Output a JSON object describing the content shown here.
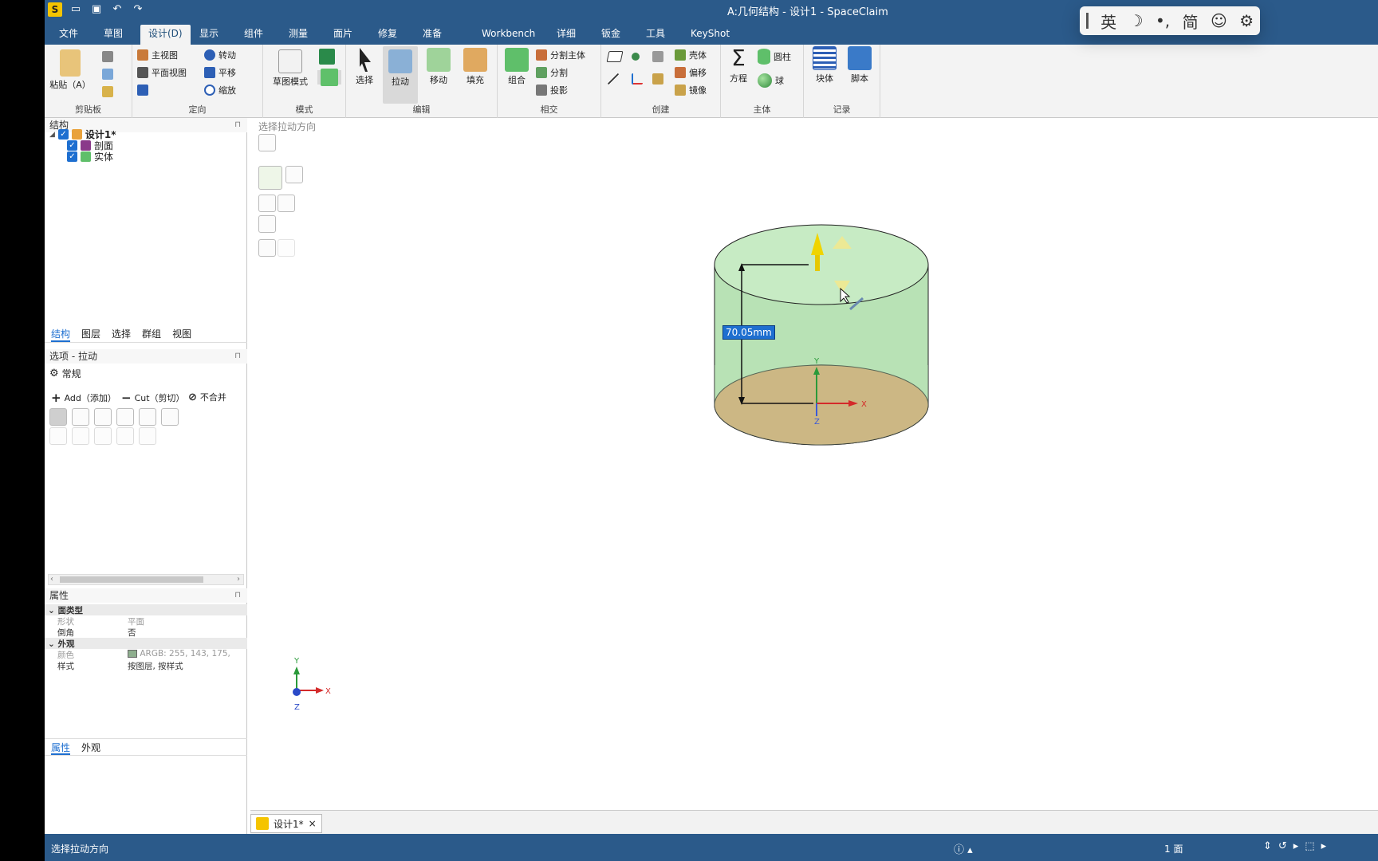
{
  "app": {
    "title": "A:几何结构 - 设计1 - SpaceClaim"
  },
  "menu_tabs": [
    "文件",
    "草图",
    "设计(D)",
    "显示",
    "组件",
    "测量",
    "面片",
    "修复",
    "准备",
    "Workbench",
    "详细",
    "钣金",
    "工具",
    "KeyShot"
  ],
  "ribbon": {
    "clipboard": {
      "title": "剪贴板",
      "paste": "粘贴（A）"
    },
    "orient": {
      "title": "定向",
      "home": "主视图",
      "plan": "平面视图",
      "spin": "转动",
      "pan": "平移",
      "zoom": "缩放"
    },
    "mode": {
      "title": "模式",
      "sketch": "草图模式"
    },
    "edit": {
      "title": "编辑",
      "select": "选择",
      "pull": "拉动",
      "move": "移动",
      "fill": "填充"
    },
    "intersect": {
      "title": "相交",
      "combine": "组合",
      "split_body": "分割主体",
      "split": "分割",
      "project": "投影"
    },
    "create": {
      "title": "创建",
      "shell": "壳体",
      "offset": "偏移",
      "mirror": "镜像"
    },
    "body": {
      "title": "主体",
      "equation": "方程",
      "cylinder": "圆柱",
      "sphere": "球"
    },
    "record": {
      "title": "记录",
      "block": "块体",
      "script": "脚本"
    }
  },
  "ime": {
    "mode": "英",
    "moon": "☽",
    "punct": "•,",
    "charset": "简",
    "emoji": "☺",
    "settings": "⚙"
  },
  "structure": {
    "title": "结构",
    "root": "设计1*",
    "items": [
      "剖面",
      "实体"
    ]
  },
  "panel_tabs": [
    "结构",
    "图层",
    "选择",
    "群组",
    "视图"
  ],
  "options": {
    "title": "选项 - 拉动",
    "general": "常规",
    "add": "Add（添加）",
    "cut": "Cut（剪切）",
    "no_merge": "不合并"
  },
  "properties": {
    "title": "属性",
    "face_type": "面类型",
    "shape_k": "形状",
    "shape_v": "平面",
    "chamfer_k": "倒角",
    "chamfer_v": "否",
    "appearance": "外观",
    "color_k": "颜色",
    "color_v": "ARGB: 255, 143, 175,",
    "style_k": "样式",
    "style_v": "按图层, 按样式"
  },
  "bottom_tabs": [
    "属性",
    "外观"
  ],
  "viewport": {
    "hint": "选择拉动方向",
    "dimension": "70.05mm"
  },
  "doc_tab": {
    "label": "设计1*",
    "close": "×"
  },
  "status": {
    "left": "选择拉动方向",
    "count": "1 面"
  },
  "colors": {
    "titlebar": "#2b5a8a",
    "cyl_side": "#b8e2b5",
    "cyl_top": "#c7ebc4",
    "cyl_bottom": "#d8a06a",
    "dimension_bg": "#1e6fd0"
  }
}
